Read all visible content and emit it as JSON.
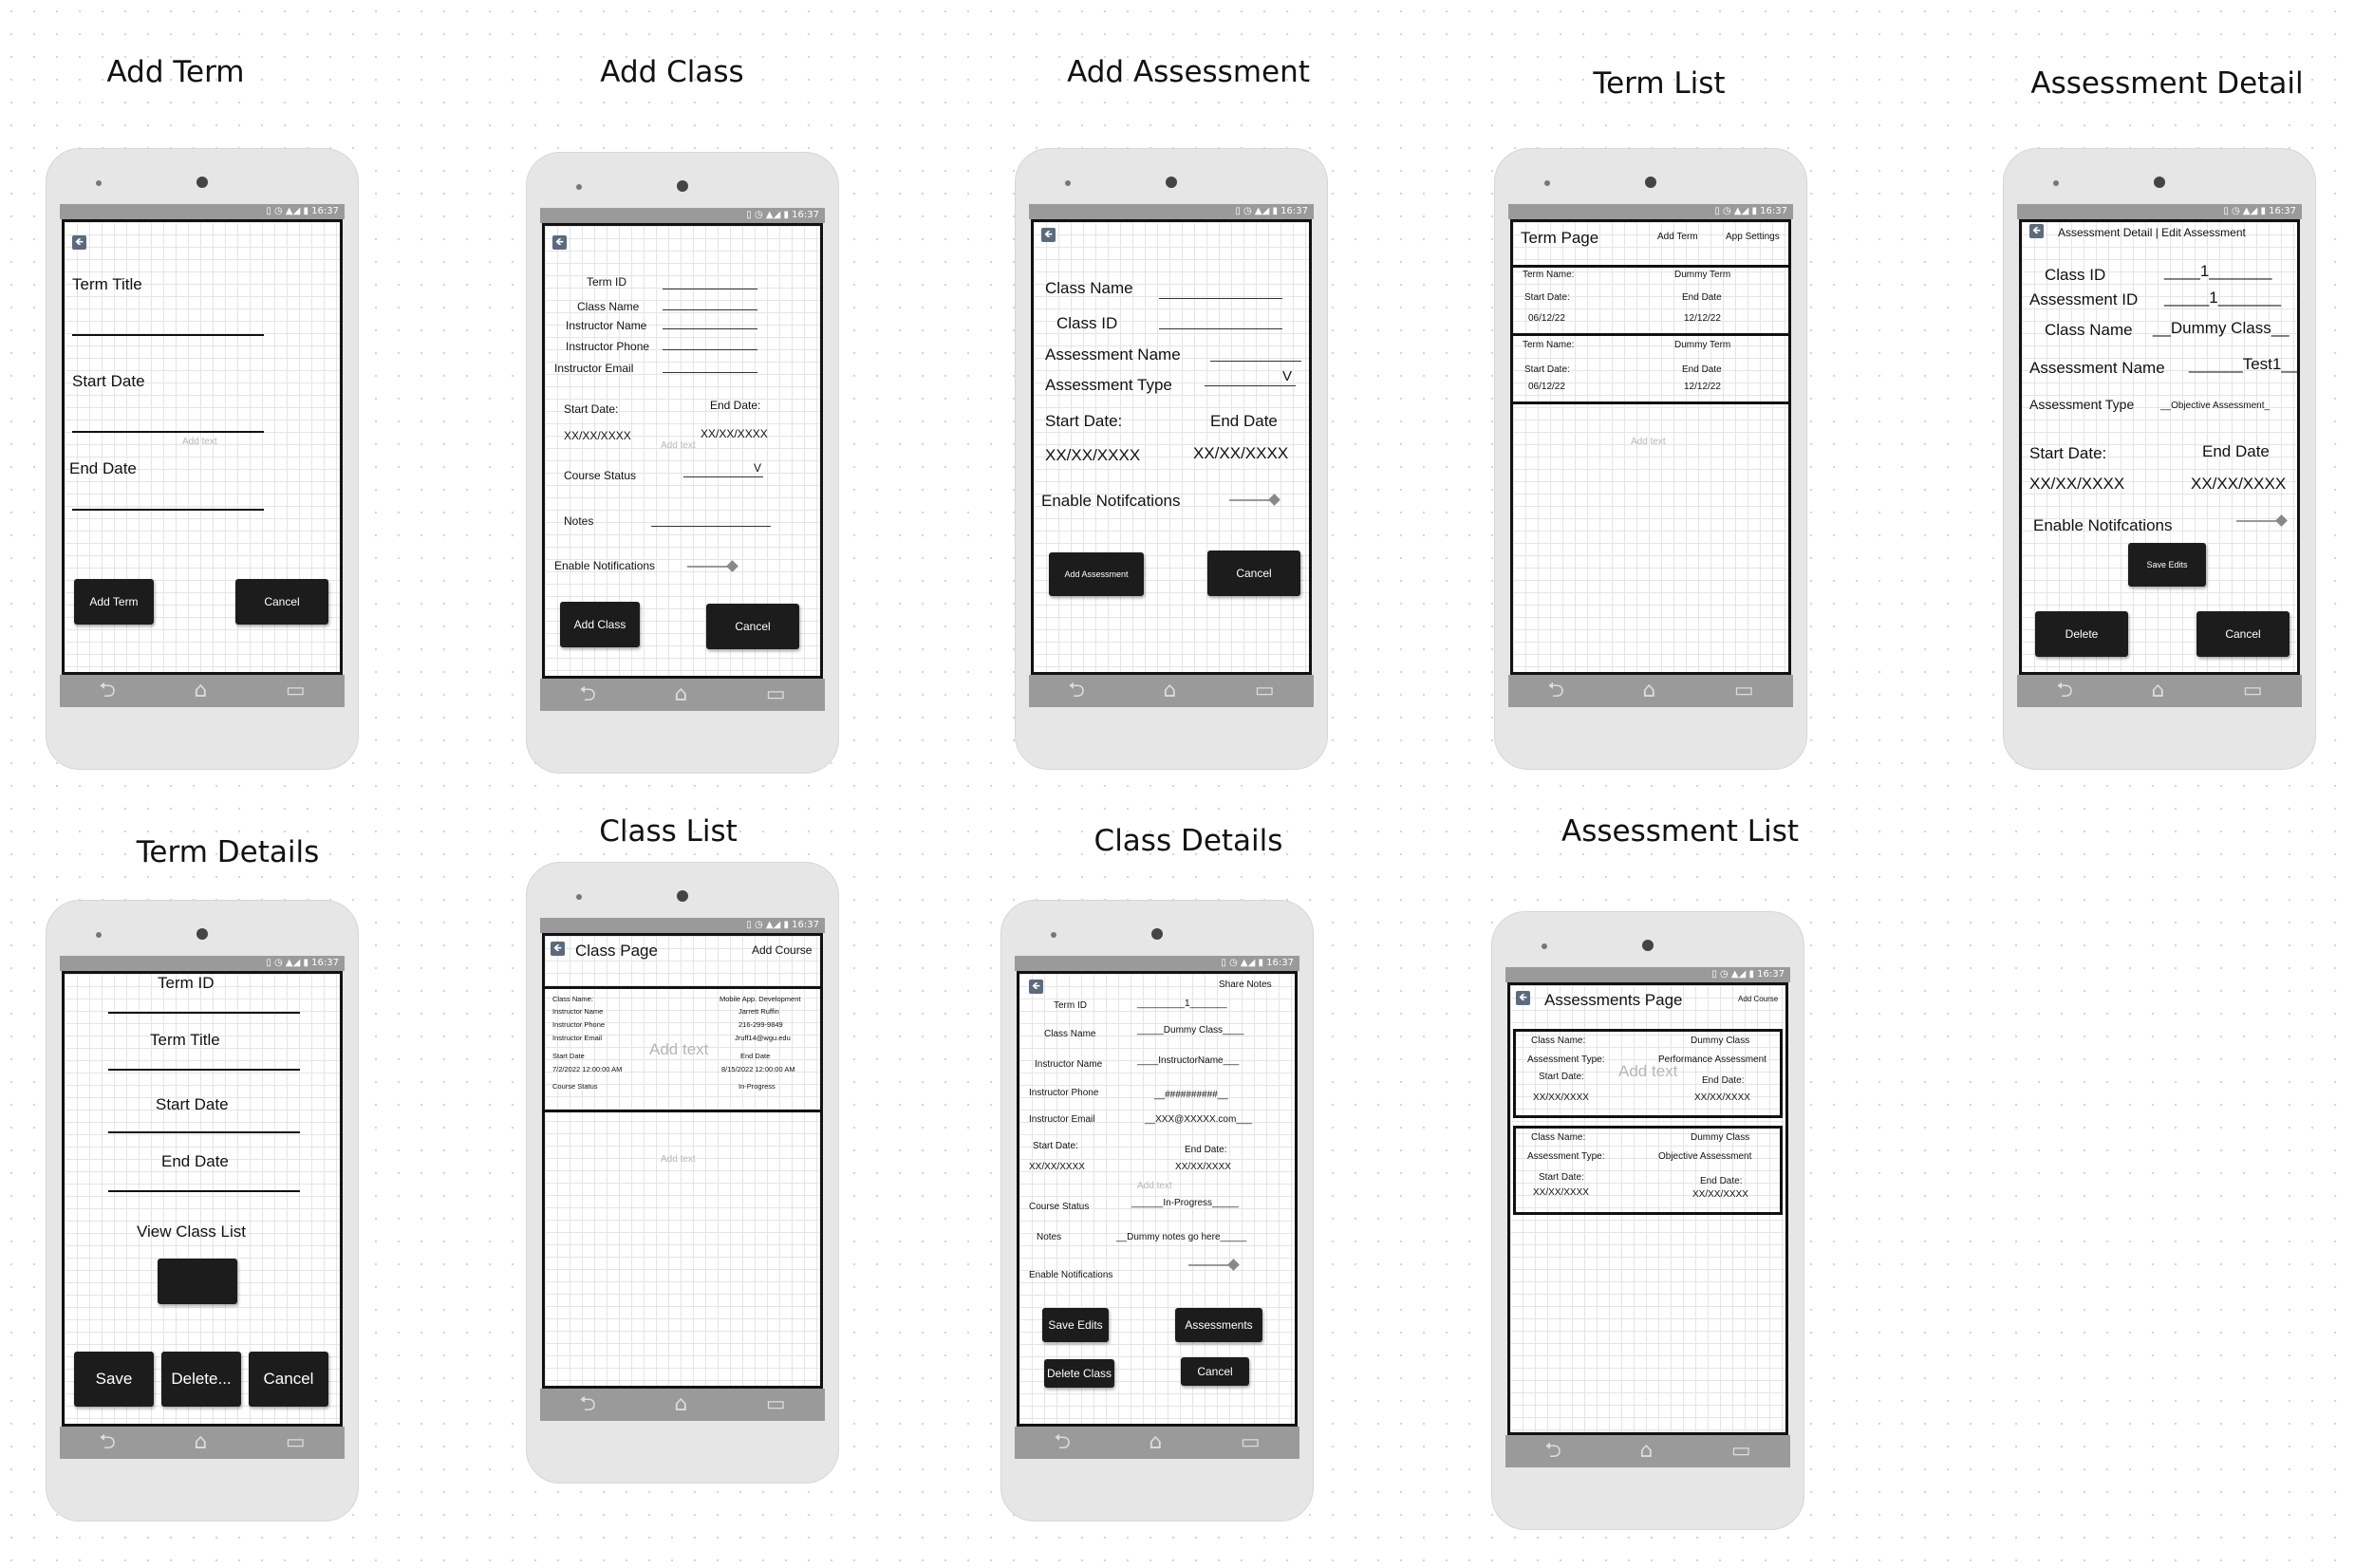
{
  "status_bar": "▯ ◷ ▲◢ ▮ 16:37",
  "nav_icons": {
    "back": "⮌",
    "home": "⌂",
    "recent": "▭"
  },
  "back_icon": "🡸",
  "hint": "Add text",
  "add_term": {
    "title": "Add Term",
    "term_title": "Term Title",
    "start_date": "Start Date",
    "end_date": "End Date",
    "add_btn": "Add Term",
    "cancel_btn": "Cancel"
  },
  "add_class": {
    "title": "Add Class",
    "term_id": "Term ID",
    "class_name": "Class Name",
    "instructor_name": "Instructor Name",
    "instructor_phone": "Instructor Phone",
    "instructor_email": "Instructor Email",
    "start_date": "Start Date:",
    "end_date": "End Date:",
    "start_value": "XX/XX/XXXX",
    "end_value": "XX/XX/XXXX",
    "course_status": "Course Status",
    "status_value": "V",
    "notes": "Notes",
    "enable_notifications": "Enable Notifications",
    "add_btn": "Add Class",
    "cancel_btn": "Cancel"
  },
  "add_assessment": {
    "title": "Add Assessment",
    "class_name": "Class Name",
    "class_id": "Class ID",
    "assessment_name": "Assessment Name",
    "assessment_type": "Assessment Type",
    "type_value": "V",
    "start_date": "Start Date:",
    "end_date": "End Date",
    "start_value": "XX/XX/XXXX",
    "end_value": "XX/XX/XXXX",
    "enable_notifications": "Enable Notifcations",
    "add_btn": "Add Assessment",
    "cancel_btn": "Cancel"
  },
  "term_list": {
    "title": "Term List",
    "header": "Term Page",
    "add_term": "Add Term",
    "app_settings": "App Settings",
    "terms": [
      {
        "label": "Term Name:",
        "name": "Dummy Term",
        "start_label": "Start Date:",
        "start": "06/12/22",
        "end_label": "End Date",
        "end": "12/12/22"
      },
      {
        "label": "Term Name:",
        "name": "Dummy Term",
        "start_label": "Start Date:",
        "start": "06/12/22",
        "end_label": "End Date",
        "end": "12/12/22"
      }
    ]
  },
  "assessment_detail": {
    "title": "Assessment Detail",
    "header": "Assessment Detail | Edit Assessment",
    "class_id": "Class ID",
    "class_id_value": "____1_______",
    "assessment_id": "Assessment ID",
    "assessment_id_value": "_____1_______",
    "class_name": "Class Name",
    "class_name_value": "__Dummy Class__",
    "assessment_name": "Assessment Name",
    "assessment_name_value": "______Test1___",
    "assessment_type": "Assessment Type",
    "assessment_type_value": "__Objective Assessment_",
    "start_date": "Start Date:",
    "end_date": "End Date",
    "start_value": "XX/XX/XXXX",
    "end_value": "XX/XX/XXXX",
    "enable_notifications": "Enable Notifcations",
    "save_btn": "Save Edits",
    "delete_btn": "Delete",
    "cancel_btn": "Cancel"
  },
  "term_details": {
    "title": "Term Details",
    "term_id": "Term ID",
    "term_title": "Term Title",
    "start_date": "Start Date",
    "end_date": "End Date",
    "view_class_list": "View Class List",
    "save_btn": "Save",
    "delete_btn": "Delete...",
    "cancel_btn": "Cancel"
  },
  "class_list": {
    "title": "Class List",
    "header": "Class Page",
    "add_course": "Add Course",
    "rows": [
      [
        "Class Name:",
        "Mobile App. Development"
      ],
      [
        "Instructor Name",
        "Jarrett Ruffin"
      ],
      [
        "Instructor Phone",
        "216-299-9849"
      ],
      [
        "Instructor Email",
        "Jruff14@wgu.edu"
      ],
      [
        "Start Date",
        "End Date"
      ],
      [
        "7/2/2022 12:00:00 AM",
        "8/15/2022 12:00:00 AM"
      ],
      [
        "Course Status",
        "In-Progress"
      ]
    ]
  },
  "class_details": {
    "title": "Class Details",
    "share_notes": "Share Notes",
    "term_id": "Term ID",
    "term_id_value": "_________1_______",
    "class_name": "Class Name",
    "class_name_value": "_____Dummy Class____",
    "instructor_name": "Instructor Name",
    "instructor_name_value": "____InstructorName___",
    "instructor_phone": "Instructor Phone",
    "instructor_phone_value": "__##########__",
    "instructor_email": "Instructor Email",
    "instructor_email_value": "__XXX@XXXXX.com___",
    "start_date": "Start Date:",
    "end_date": "End Date:",
    "start_value": "XX/XX/XXXX",
    "end_value": "XX/XX/XXXX",
    "course_status": "Course Status",
    "course_status_value": "______In-Progress_____",
    "notes": "Notes",
    "notes_value": "__Dummy notes go here_____",
    "enable_notifications": "Enable Notifications",
    "save_btn": "Save Edits",
    "assessments_btn": "Assessments",
    "delete_btn": "Delete Class",
    "cancel_btn": "Cancel"
  },
  "assessment_list": {
    "title": "Assessment List",
    "header": "Assessments Page",
    "add_course": "Add Course",
    "cards": [
      {
        "class_label": "Class Name:",
        "class": "Dummy Class",
        "type_label": "Assessment Type:",
        "type": "Performance Assessment",
        "start_label": "Start Date:",
        "start": "XX/XX/XXXX",
        "end_label": "End Date:",
        "end": "XX/XX/XXXX"
      },
      {
        "class_label": "Class Name:",
        "class": "Dummy Class",
        "type_label": "Assessment Type:",
        "type": "Objective Assessment",
        "start_label": "Start Date:",
        "start": "XX/XX/XXXX",
        "end_label": "End Date:",
        "end": "XX/XX/XXXX"
      }
    ]
  }
}
